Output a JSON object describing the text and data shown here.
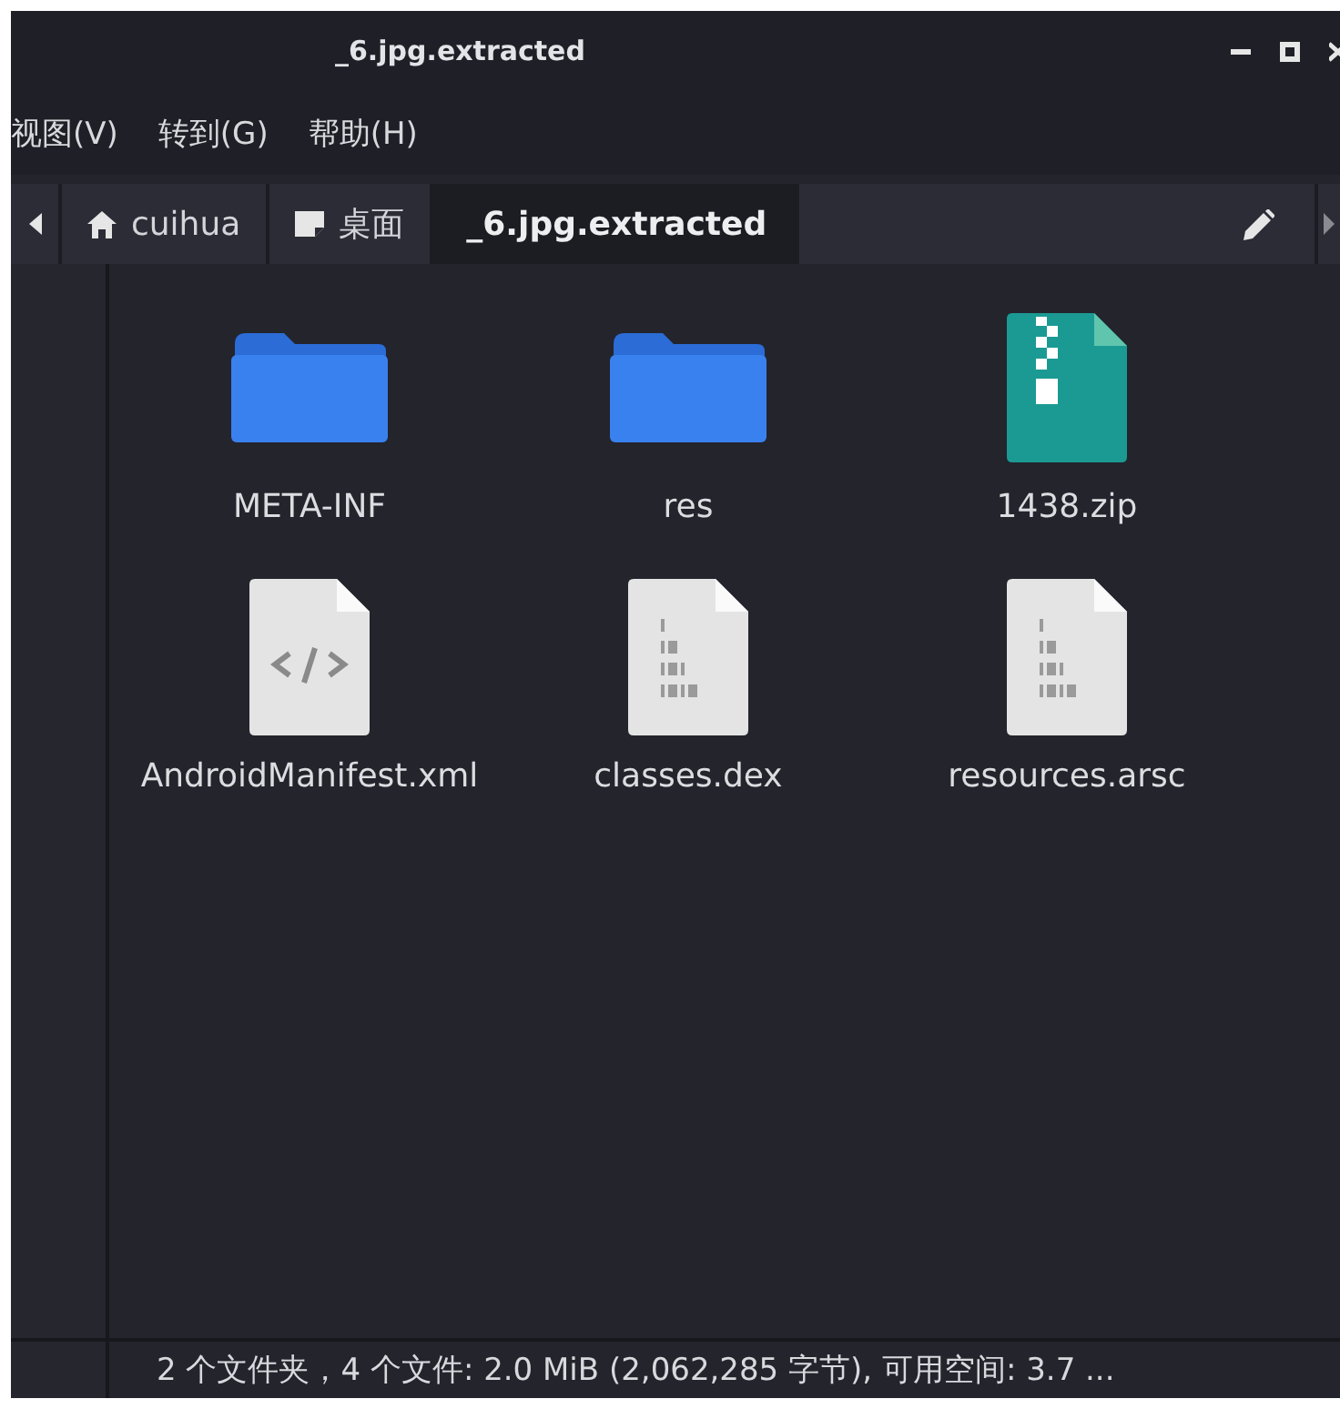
{
  "window": {
    "title": "_6.jpg.extracted"
  },
  "menu": [
    "视图(V)",
    "转到(G)",
    "帮助(H)"
  ],
  "path_bar": [
    {
      "label": "cuihua",
      "kind": "home",
      "selected": false
    },
    {
      "label": "桌面",
      "kind": "desktop",
      "selected": false
    },
    {
      "label": "_6.jpg.extracted",
      "kind": "plain",
      "selected": true
    }
  ],
  "files": [
    {
      "name": "META-INF",
      "kind": "folder"
    },
    {
      "name": "res",
      "kind": "folder"
    },
    {
      "name": "1438.zip",
      "kind": "zip"
    },
    {
      "name": "AndroidManifest.xml",
      "kind": "code"
    },
    {
      "name": "classes.dex",
      "kind": "binary"
    },
    {
      "name": "resources.arsc",
      "kind": "binary"
    }
  ],
  "status_bar": "2 个文件夹，4 个文件: 2.0 MiB (2,062,285 字节), 可用空间: 3.7 ..."
}
